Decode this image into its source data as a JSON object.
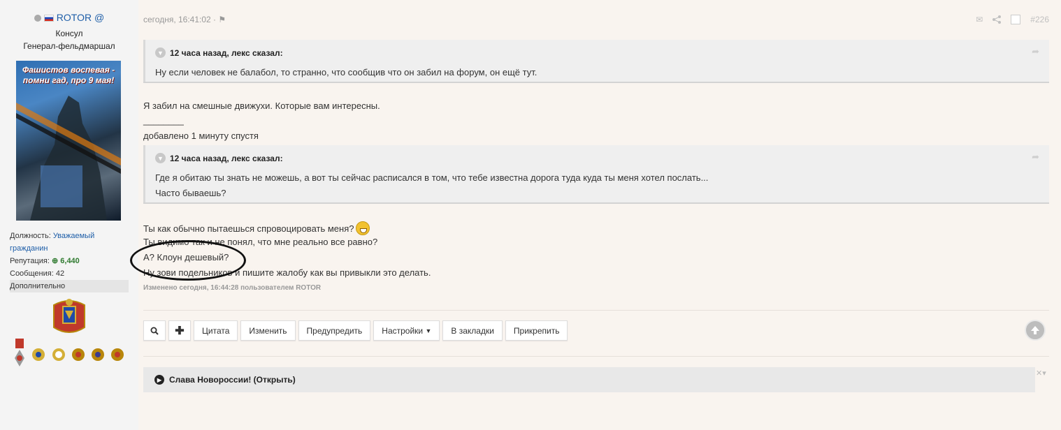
{
  "sidebar": {
    "username": "ROTOR",
    "at": "@",
    "rank": "Консул",
    "title": "Генерал-фельдмаршал",
    "avatar_caption": "Фашистов воспевая - помни гад, про 9 мая!",
    "position_label": "Должность:",
    "position_value_1": "Уважаемый",
    "position_value_2": "гражданин",
    "reputation_label": "Репутация:",
    "reputation_value": "6,440",
    "messages_label": "Сообщения:",
    "messages_value": "42",
    "more_label": "Дополнительно"
  },
  "post": {
    "timestamp": "сегодня, 16:41:02",
    "separator": "·",
    "number": "#226",
    "quote1": {
      "author": "12 часа назад, лекс сказал:",
      "line1": "Ну если человек не балабол, то странно, что сообщив что он забил на форум, он ещё тут."
    },
    "reply1": "Я забил на смешные движухи. Которые вам интересны.",
    "rule": "________",
    "added": "добавлено 1 минуту спустя",
    "quote2": {
      "author": "12 часа назад, лекс сказал:",
      "line1": "Где я обитаю ты знать не можешь, а вот ты сейчас расписался в том, что тебе известна дорога туда куда ты меня хотел послать...",
      "line2": "Часто бываешь?"
    },
    "body": [
      "Ты как обычно пытаешься спровоцировать меня?",
      "Ты видимо так и не понял, что мне реально все равно?",
      "А? Клоун дешевый?",
      "Ну зови подельников и пишите жалобу как вы привыкли это делать."
    ],
    "edited": "Изменено сегодня, 16:44:28 пользователем ROTOR"
  },
  "actions": {
    "quote": "Цитата",
    "edit": "Изменить",
    "warn": "Предупредить",
    "settings": "Настройки",
    "bookmarks": "В закладки",
    "pin": "Прикрепить"
  },
  "spoiler": {
    "label": "Слава Новороссии! (Открыть)"
  }
}
